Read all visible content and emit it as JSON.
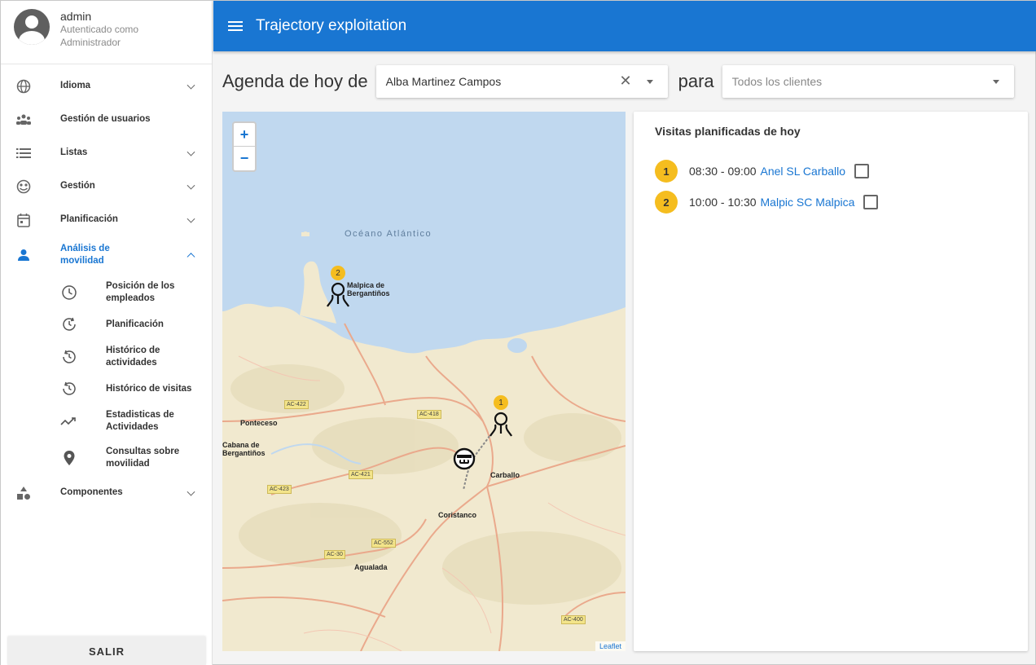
{
  "user": {
    "name": "admin",
    "role_line1": "Autenticado como",
    "role_line2": "Administrador"
  },
  "sidebar": {
    "items": [
      {
        "label": "Idioma",
        "icon": "globe-icon"
      },
      {
        "label": "Gestión de usuarios",
        "icon": "group-icon"
      },
      {
        "label": "Listas",
        "icon": "list-icon"
      },
      {
        "label": "Gestión",
        "icon": "dashboard-icon"
      },
      {
        "label": "Planificación",
        "icon": "calendar-icon"
      },
      {
        "label": "Análisis de movilidad",
        "icon": "person-icon"
      },
      {
        "label": "Componentes",
        "icon": "shapes-icon"
      }
    ],
    "subitems": [
      {
        "label": "Posición de los empleados",
        "icon": "clock-icon"
      },
      {
        "label": "Planificación",
        "icon": "refresh-clock-icon"
      },
      {
        "label": "Histórico de actividades",
        "icon": "history-icon"
      },
      {
        "label": "Histórico de visitas",
        "icon": "history-icon"
      },
      {
        "label": "Estadisticas de Actividades",
        "icon": "trending-icon"
      },
      {
        "label": "Consultas sobre movilidad",
        "icon": "location-pin-icon"
      }
    ],
    "logout": "SALIR"
  },
  "topbar": {
    "title": "Trajectory exploitation"
  },
  "filter": {
    "prefix": "Agenda de hoy de",
    "employee": "Alba Martinez Campos",
    "connector": "para",
    "client_placeholder": "Todos los clientes"
  },
  "map": {
    "zoom_in": "+",
    "zoom_out": "−",
    "ocean": "Océano Atlántico",
    "towns": [
      "Malpica de Bergantiños",
      "Ponteceso",
      "Cabana de Bergantiños",
      "Carballo",
      "Coristanco",
      "Agualada"
    ],
    "roads": [
      "AC-422",
      "AC-418",
      "AC-421",
      "AC-423",
      "AC-552",
      "AC-30",
      "AC-400"
    ],
    "markers": [
      "1",
      "2"
    ],
    "attribution": "Leaflet"
  },
  "visits": {
    "heading": "Visitas planificadas de hoy",
    "items": [
      {
        "num": "1",
        "time": "08:30 - 09:00",
        "client": "Anel SL Carballo"
      },
      {
        "num": "2",
        "time": "10:00 - 10:30",
        "client": "Malpic SC Malpica"
      }
    ]
  },
  "colors": {
    "primary": "#1976d2",
    "marker": "#f5bd1f",
    "ocean": "#c0d8ef",
    "land": "#f1e9cf"
  }
}
